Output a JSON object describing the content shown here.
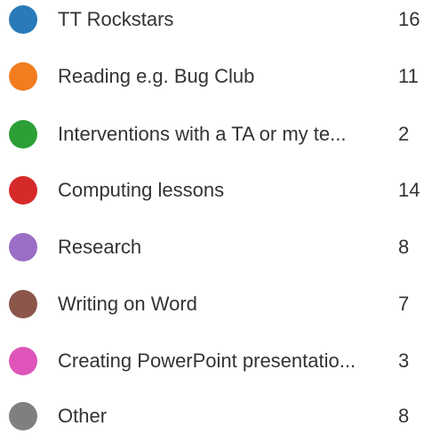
{
  "legend": {
    "items": [
      {
        "label": "TT Rockstars",
        "count": "16",
        "color": "#2a7ab9"
      },
      {
        "label": "Reading e.g. Bug Club",
        "count": "11",
        "color": "#f17d1f"
      },
      {
        "label": "Interventions with a TA or my te...",
        "count": "2",
        "color": "#2ca037"
      },
      {
        "label": "Computing lessons",
        "count": "14",
        "color": "#d62a2a"
      },
      {
        "label": "Research",
        "count": "8",
        "color": "#9b6ec6"
      },
      {
        "label": "Writing on Word",
        "count": "7",
        "color": "#8c564b"
      },
      {
        "label": "Creating PowerPoint presentatio...",
        "count": "3",
        "color": "#de54b8"
      },
      {
        "label": "Other",
        "count": "8",
        "color": "#7f7f7f"
      }
    ]
  }
}
